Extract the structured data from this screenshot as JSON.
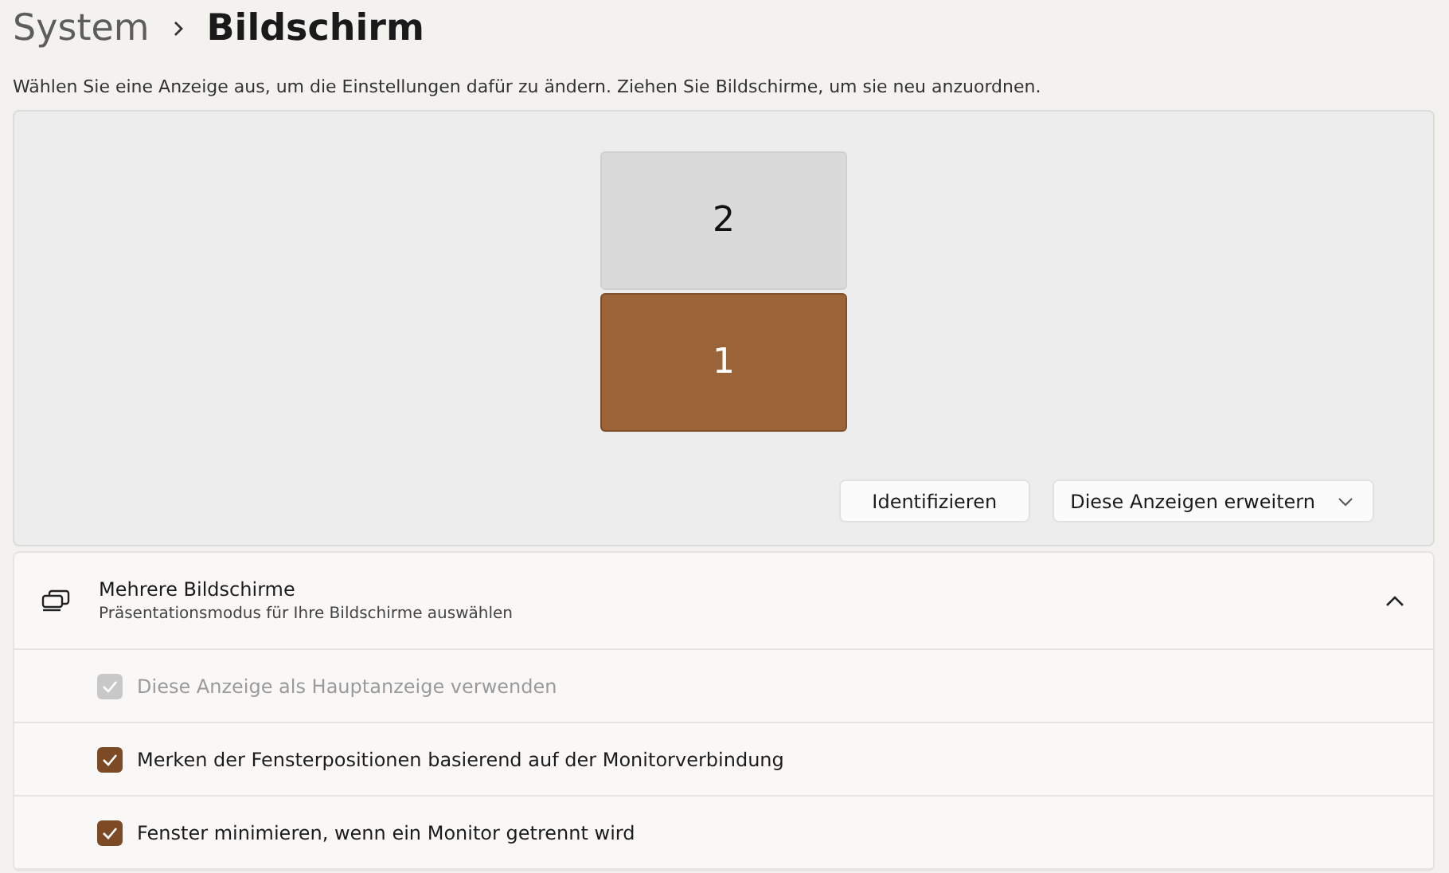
{
  "breadcrumb": {
    "parent": "System",
    "current": "Bildschirm"
  },
  "description": "Wählen Sie eine Anzeige aus, um die Einstellungen dafür zu ändern. Ziehen Sie Bildschirme, um sie neu anzuordnen.",
  "displays": [
    {
      "label": "2",
      "selected": false
    },
    {
      "label": "1",
      "selected": true
    }
  ],
  "identify_button": "Identifizieren",
  "mode_dropdown": {
    "value": "Diese Anzeigen erweitern"
  },
  "section": {
    "title": "Mehrere Bildschirme",
    "subtitle": "Präsentationsmodus für Ihre Bildschirme auswählen",
    "expanded": true
  },
  "options": [
    {
      "label": "Diese Anzeige als Hauptanzeige verwenden",
      "checked": true,
      "disabled": true
    },
    {
      "label": "Merken der Fensterpositionen basierend auf der Monitorverbindung",
      "checked": true,
      "disabled": false
    },
    {
      "label": "Fenster minimieren, wenn ein Monitor getrennt wird",
      "checked": true,
      "disabled": false
    }
  ]
}
